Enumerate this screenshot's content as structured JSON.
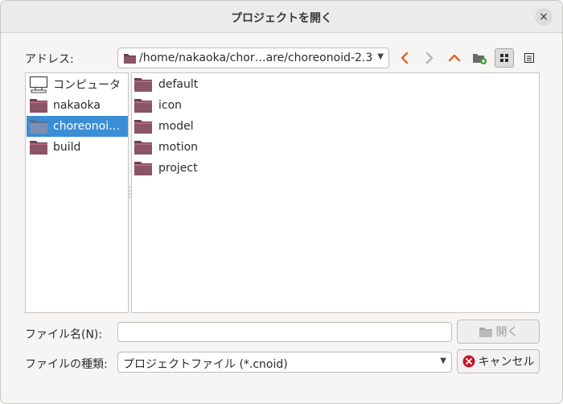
{
  "dialog": {
    "title": "プロジェクトを開く",
    "close_icon": "×"
  },
  "address": {
    "label": "アドレス:",
    "path": "/home/nakaoka/chor…are/choreonoid-2.3"
  },
  "toolbar": {
    "back": "‹",
    "forward": "›",
    "parent": "^"
  },
  "sidebar": {
    "items": [
      {
        "label": "コンピュータ",
        "icon": "computer-icon"
      },
      {
        "label": "nakaoka",
        "icon": "folder-icon"
      },
      {
        "label": "choreonoi…",
        "icon": "folder-icon",
        "selected": true
      },
      {
        "label": "build",
        "icon": "folder-icon"
      }
    ]
  },
  "files": [
    {
      "name": "default"
    },
    {
      "name": "icon"
    },
    {
      "name": "model"
    },
    {
      "name": "motion"
    },
    {
      "name": "project"
    }
  ],
  "filename": {
    "label": "ファイル名(N):",
    "value": "",
    "placeholder": ""
  },
  "filetype": {
    "label": "ファイルの種類:",
    "selected": "プロジェクトファイル (*.cnoid)"
  },
  "buttons": {
    "open": "開く",
    "cancel": "キャンセル"
  },
  "colors": {
    "selection": "#3a8ed6",
    "folder": "#6b3f4f",
    "accent_orange": "#e0622a",
    "cancel_red": "#c7162b"
  }
}
